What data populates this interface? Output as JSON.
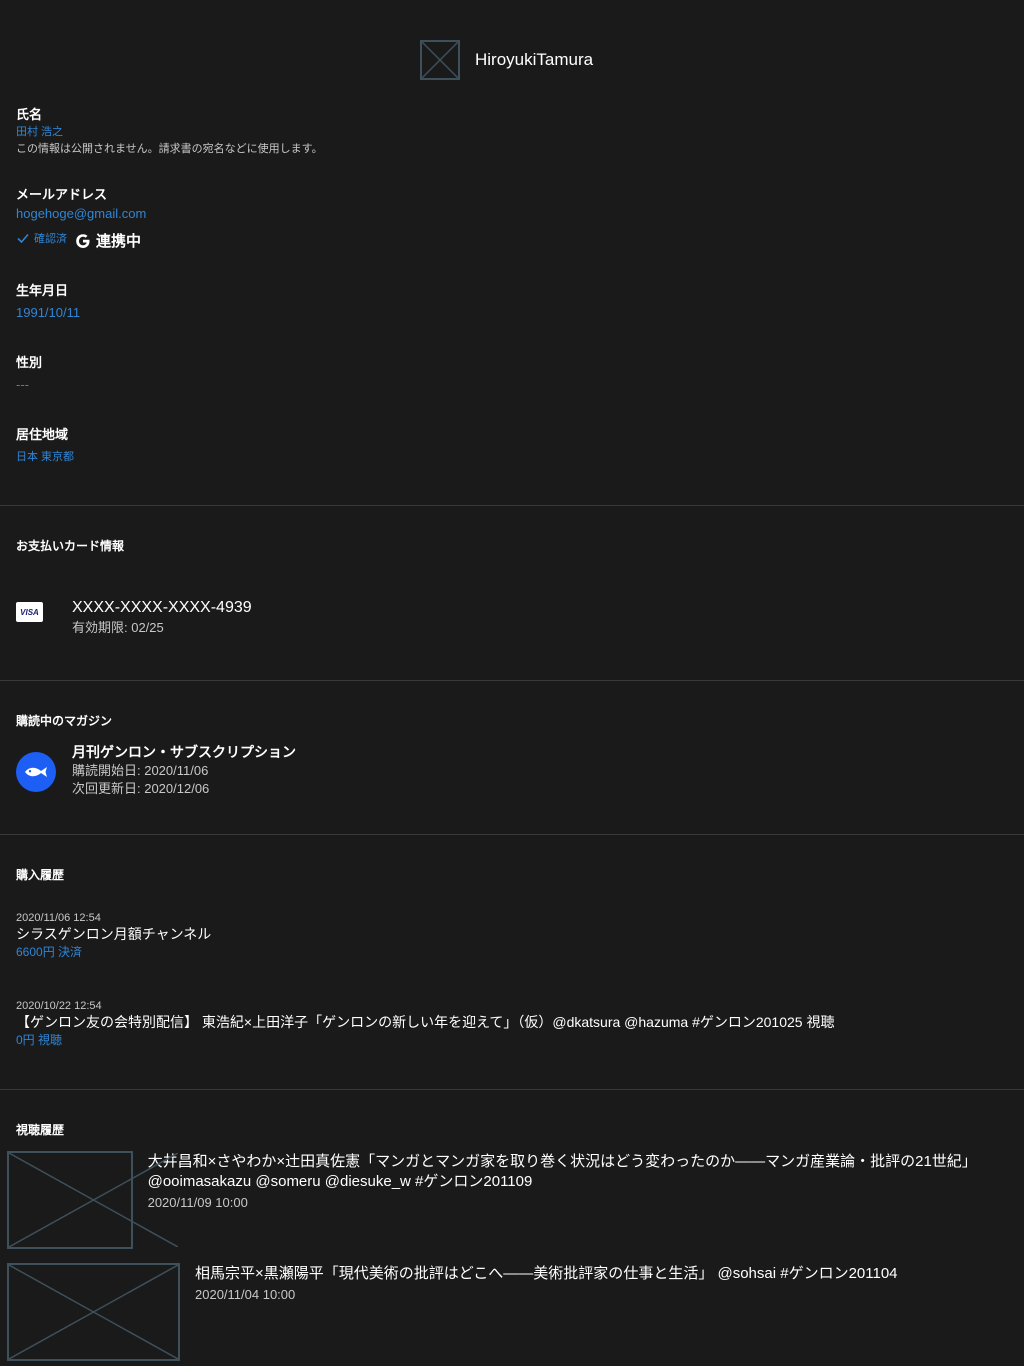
{
  "profile": {
    "name": "HiroyukiTamura"
  },
  "fields": {
    "name": {
      "label": "氏名",
      "value": "田村 浩之",
      "desc": "この情報は公開されません。請求書の宛名などに使用します。"
    },
    "email": {
      "label": "メールアドレス",
      "value": "hogehoge@gmail.com",
      "verified_label": "確認済",
      "google_label": "連携中"
    },
    "birthday": {
      "label": "生年月日",
      "value": "1991/10/11"
    },
    "gender": {
      "label": "性別",
      "value": "---"
    },
    "location": {
      "label": "居住地域",
      "value": "日本 東京都"
    }
  },
  "payment": {
    "title": "お支払いカード情報",
    "card_brand": "VISA",
    "card_number": "XXXX-XXXX-XXXX-4939",
    "card_expiry": "有効期限: 02/25"
  },
  "subscription": {
    "title": "購読中のマガジン",
    "name": "月刊ゲンロン・サブスクリプション",
    "start_date": "購読開始日: 2020/11/06",
    "next_date": "次回更新日: 2020/12/06"
  },
  "history": {
    "title": "購入履歴",
    "items": [
      {
        "date": "2020/11/06 12:54",
        "title": "シラスゲンロン月額チャンネル",
        "amount": "6600円 決済"
      },
      {
        "date": "2020/10/22 12:54",
        "title": "【ゲンロン友の会特別配信】 東浩紀×上田洋子「ゲンロンの新しい年を迎えて」（仮）@dkatsura @hazuma #ゲンロン201025 視聴",
        "amount": "0円 視聴"
      }
    ]
  },
  "contents": {
    "title": "視聴履歴",
    "items": [
      {
        "title": "大井昌和×さやわか×辻田真佐憲「マンガとマンガ家を取り巻く状況はどう変わったのか——マンガ産業論・批評の21世紀」 @ooimasakazu @someru @diesuke_w #ゲンロン201109",
        "date": "2020/11/09 10:00"
      },
      {
        "title": "相馬宗平×黒瀬陽平「現代美術の批評はどこへ——美術批評家の仕事と生活」 @sohsai #ゲンロン201104",
        "date": "2020/11/04 10:00"
      }
    ]
  }
}
